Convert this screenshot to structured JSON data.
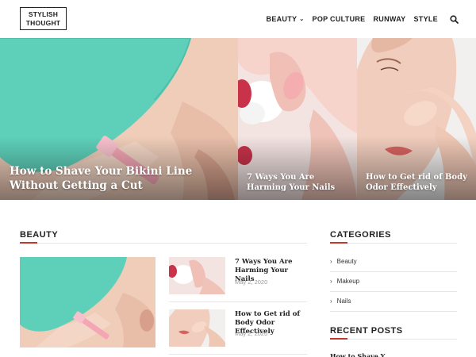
{
  "site": {
    "logo_line1": "STYLISH",
    "logo_line2": "THOUGHT"
  },
  "nav": {
    "items": [
      {
        "label": "BEAUTY",
        "has_dropdown": true
      },
      {
        "label": "POP CULTURE",
        "has_dropdown": false
      },
      {
        "label": "RUNWAY",
        "has_dropdown": false
      },
      {
        "label": "STYLE",
        "has_dropdown": false
      }
    ],
    "search_icon": "search-icon"
  },
  "hero": {
    "main": {
      "title": "How to Shave Your Bikini Line Without Getting a Cut"
    },
    "second": {
      "title": "7 Ways You Are Harming Your Nails"
    },
    "third": {
      "title": "How to Get rid of Body Odor Effectively"
    }
  },
  "beauty": {
    "heading": "BEAUTY",
    "posts": [
      {
        "title": "7 Ways You Are Harming Your Nails",
        "date": "May 2, 2020"
      },
      {
        "title": "How to Get rid of Body Odor Effectively",
        "date": "May 2, 2020"
      }
    ]
  },
  "categories": {
    "heading": "CATEGORIES",
    "items": [
      "Beauty",
      "Makeup",
      "Nails"
    ]
  },
  "recent": {
    "heading": "RECENT POSTS",
    "peek_title": "How to Shave Y"
  },
  "colors": {
    "accent": "#c0392b",
    "mint": "#5fd1bb",
    "skin": "#efc9b4"
  }
}
